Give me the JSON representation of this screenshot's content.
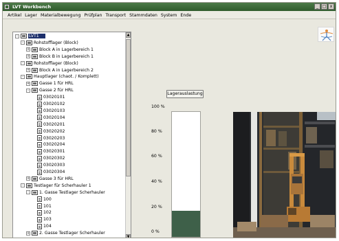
{
  "window": {
    "title": "LVT Workbench",
    "controls": [
      "_",
      "□",
      "x"
    ]
  },
  "menu": [
    "Artikel",
    "Lager",
    "Materialbewegung",
    "Prüfplan",
    "Transport",
    "Stammdaten",
    "System",
    "Ende"
  ],
  "tree": {
    "nodes": [
      {
        "label": "LVT1",
        "level": 0,
        "expander": "-",
        "icon": "folder-icon",
        "selected": true
      },
      {
        "label": "Rohstofflager (Block)",
        "level": 1,
        "expander": "-",
        "icon": "folder-icon"
      },
      {
        "label": "Block A in Lagerbereich 1",
        "level": 2,
        "expander": "+",
        "icon": "folder-icon"
      },
      {
        "label": "Block B in Lagerbereich 1",
        "level": 2,
        "expander": "+",
        "icon": "folder-icon"
      },
      {
        "label": "Rohstofflager (Block)",
        "level": 1,
        "expander": "-",
        "icon": "folder-icon"
      },
      {
        "label": "Block A in Lagerbereich 2",
        "level": 2,
        "expander": "+",
        "icon": "folder-icon"
      },
      {
        "label": "Hauptlager (chaot. / Komplett)",
        "level": 1,
        "expander": "-",
        "icon": "folder-icon"
      },
      {
        "label": "Gasse 1 für HRL",
        "level": 2,
        "expander": "+",
        "icon": "folder-icon"
      },
      {
        "label": "Gasse 2 für HRL",
        "level": 2,
        "expander": "-",
        "icon": "folder-icon"
      },
      {
        "label": "03020101",
        "level": 3,
        "expander": "",
        "icon": "document-icon"
      },
      {
        "label": "03020102",
        "level": 3,
        "expander": "",
        "icon": "document-icon"
      },
      {
        "label": "03020103",
        "level": 3,
        "expander": "",
        "icon": "document-icon"
      },
      {
        "label": "03020104",
        "level": 3,
        "expander": "",
        "icon": "document-icon"
      },
      {
        "label": "03020201",
        "level": 3,
        "expander": "",
        "icon": "document-icon"
      },
      {
        "label": "03020202",
        "level": 3,
        "expander": "",
        "icon": "document-icon"
      },
      {
        "label": "03020203",
        "level": 3,
        "expander": "",
        "icon": "document-icon"
      },
      {
        "label": "03020204",
        "level": 3,
        "expander": "",
        "icon": "document-icon"
      },
      {
        "label": "03020301",
        "level": 3,
        "expander": "",
        "icon": "document-icon"
      },
      {
        "label": "03020302",
        "level": 3,
        "expander": "",
        "icon": "document-icon"
      },
      {
        "label": "03020303",
        "level": 3,
        "expander": "",
        "icon": "document-icon"
      },
      {
        "label": "03020304",
        "level": 3,
        "expander": "",
        "icon": "document-icon"
      },
      {
        "label": "Gasse 3 für HRL",
        "level": 2,
        "expander": "+",
        "icon": "folder-icon"
      },
      {
        "label": "Testlager für Scherhauler 1",
        "level": 1,
        "expander": "-",
        "icon": "folder-icon"
      },
      {
        "label": "1. Gasse Testlager Scherhauler",
        "level": 2,
        "expander": "-",
        "icon": "folder-icon"
      },
      {
        "label": "100",
        "level": 3,
        "expander": "",
        "icon": "document-icon"
      },
      {
        "label": "101",
        "level": 3,
        "expander": "",
        "icon": "document-icon"
      },
      {
        "label": "102",
        "level": 3,
        "expander": "",
        "icon": "document-icon"
      },
      {
        "label": "103",
        "level": 3,
        "expander": "",
        "icon": "document-icon"
      },
      {
        "label": "104",
        "level": 3,
        "expander": "",
        "icon": "document-icon"
      },
      {
        "label": "2. Gasse Testlager Scherhauler",
        "level": 2,
        "expander": "+",
        "icon": "folder-icon"
      }
    ],
    "scroll_up": "▲",
    "scroll_down": "▼"
  },
  "utilization": {
    "button_label": "Lagerauslastung",
    "ticks": [
      "100 %",
      "80 %",
      "60 %",
      "40 %",
      "20 %",
      "0 %"
    ],
    "fill_percent": 21,
    "fill_color": "#3e6049"
  },
  "colors": {
    "titlebar": "#3e6a3a",
    "selection": "#1d2f6b",
    "window_bg": "#e9e8df"
  }
}
